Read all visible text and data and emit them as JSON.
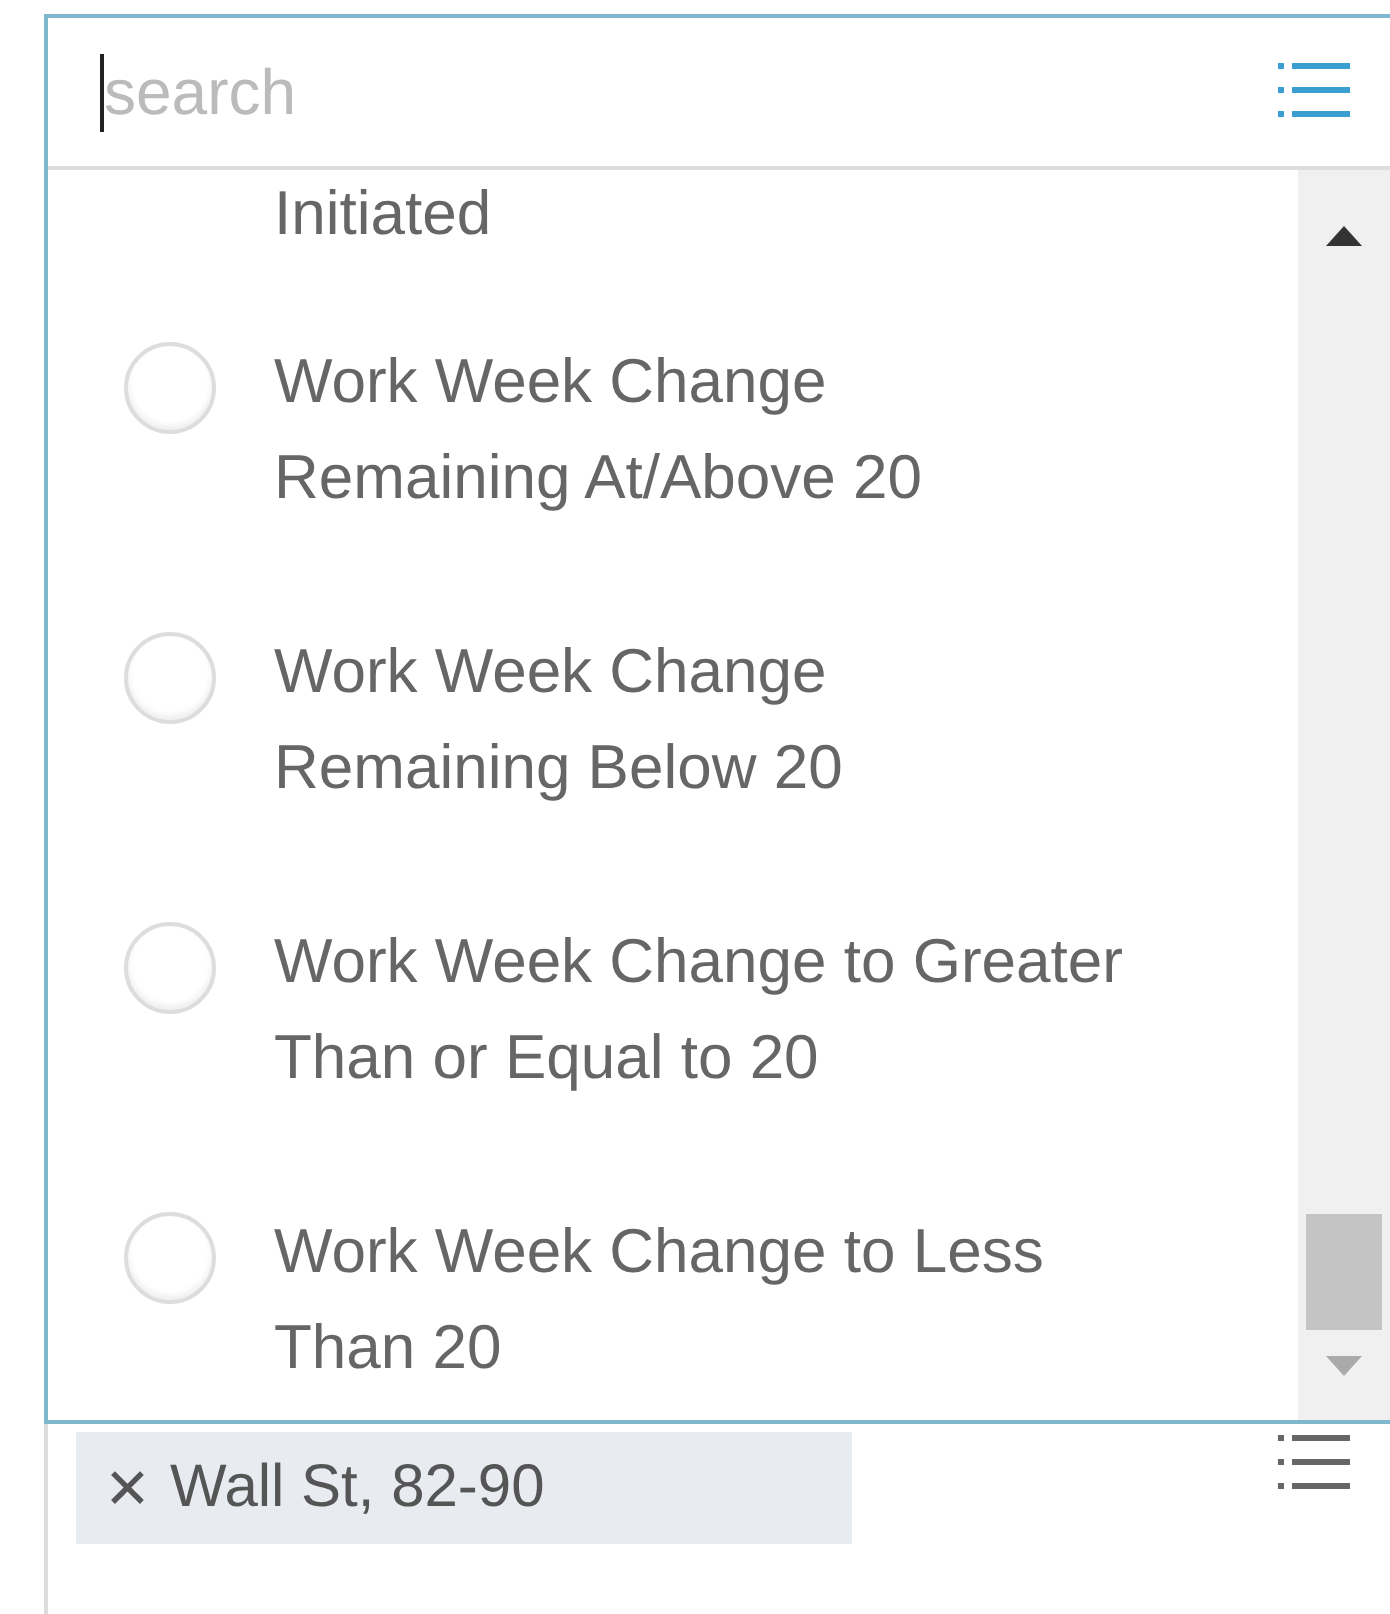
{
  "search": {
    "placeholder": "search"
  },
  "previous_option": {
    "label": "Initiated"
  },
  "options": [
    {
      "label": "Work Week Change Remaining At/Above 20",
      "selected": false
    },
    {
      "label": "Work Week Change Remaining Below 20",
      "selected": false
    },
    {
      "label": "Work Week Change to Greater Than or Equal to 20",
      "selected": false
    },
    {
      "label": "Work Week Change to Less Than 20",
      "selected": false
    }
  ],
  "selection": {
    "tags": [
      {
        "label": "Wall St, 82-90",
        "remove": "✕"
      }
    ]
  }
}
